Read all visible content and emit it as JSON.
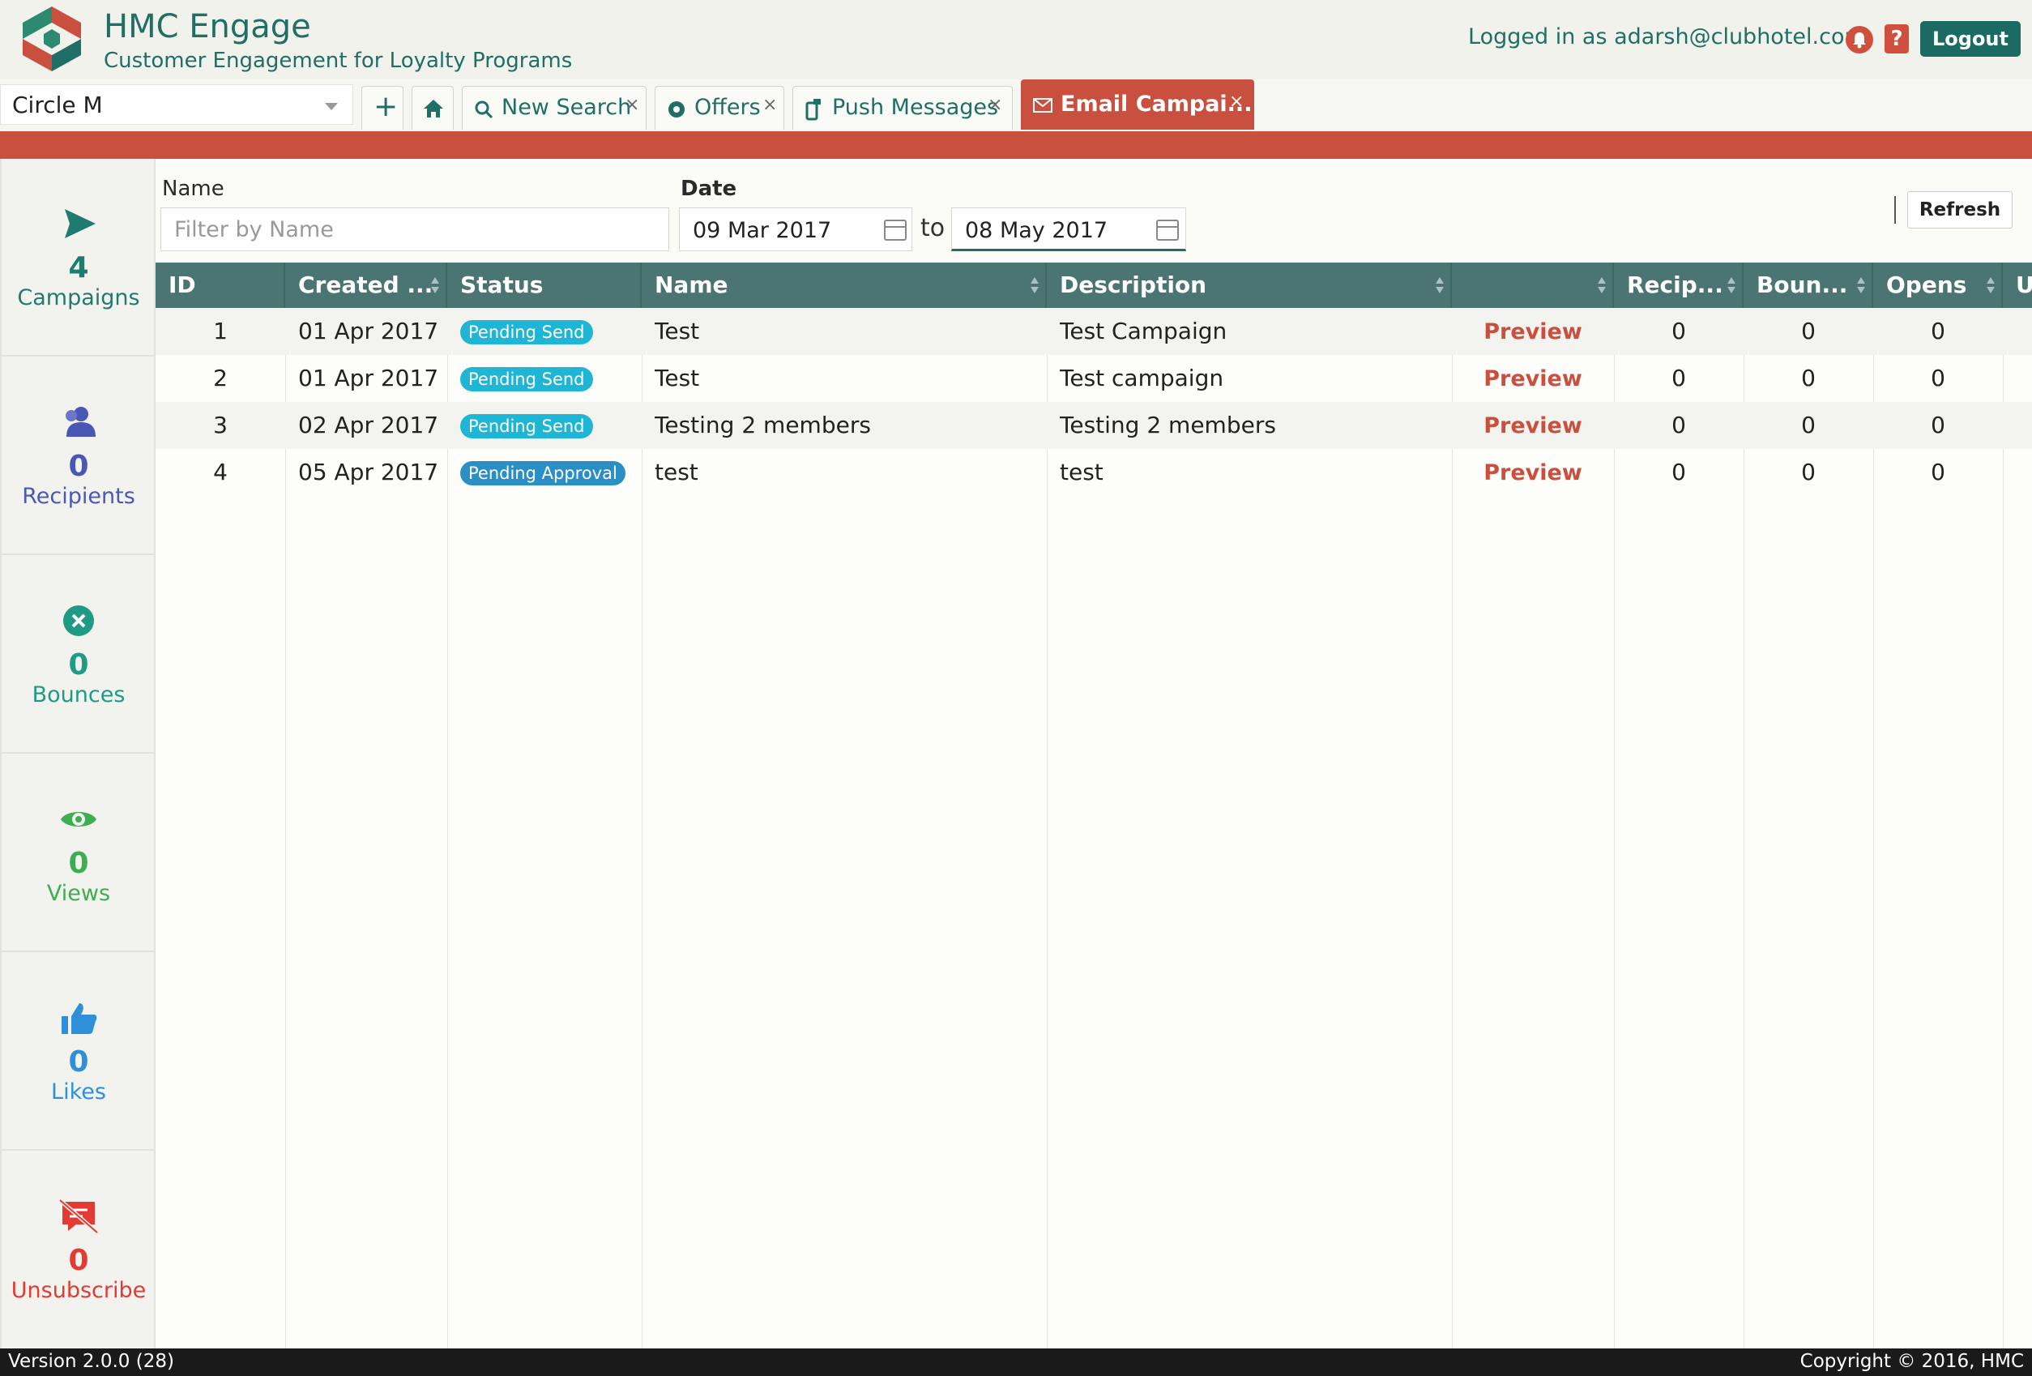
{
  "header": {
    "title": "HMC Engage",
    "subtitle": "Customer Engagement for Loyalty Programs",
    "login_text": "Logged in as adarsh@clubhotel.com",
    "help_label": "?",
    "logout_label": "Logout"
  },
  "tabbar": {
    "circle_value": "Circle M",
    "add_label": "+",
    "tabs": [
      {
        "label": "New Search",
        "icon": "search-icon",
        "close": "×"
      },
      {
        "label": "Offers",
        "icon": "gear-icon",
        "close": "×"
      },
      {
        "label": "Push Messages",
        "icon": "phone-icon",
        "close": "×"
      },
      {
        "label": "Email Campai...",
        "icon": "envelope-icon",
        "close": "×"
      }
    ]
  },
  "sidebar": {
    "stats": [
      {
        "value": "4",
        "label": "Campaigns",
        "icon": "send-icon",
        "color": "#1f7a70"
      },
      {
        "value": "0",
        "label": "Recipients",
        "icon": "users-icon",
        "color": "#4a57b5"
      },
      {
        "value": "0",
        "label": "Bounces",
        "icon": "x-circle-icon",
        "color": "#1f9a84"
      },
      {
        "value": "0",
        "label": "Views",
        "icon": "eye-icon",
        "color": "#3fae52"
      },
      {
        "value": "0",
        "label": "Likes",
        "icon": "thumbs-up-icon",
        "color": "#2f8fd8"
      },
      {
        "value": "0",
        "label": "Unsubscribe",
        "icon": "unsubscribe-icon",
        "color": "#e23b33"
      }
    ]
  },
  "filters": {
    "name_label": "Name",
    "name_placeholder": "Filter by Name",
    "date_label": "Date",
    "date_from": "09 Mar 2017",
    "to_label": "to",
    "date_to": "08 May 2017",
    "refresh_label": "Refresh"
  },
  "table": {
    "headers": [
      "ID",
      "Created ...",
      "Status",
      "Name",
      "Description",
      "",
      "Recip...",
      "Boun...",
      "Opens",
      "U"
    ],
    "rows": [
      {
        "id": "1",
        "created": "01 Apr 2017",
        "status": "Pending Send",
        "name": "Test",
        "description": "Test Campaign",
        "action": "Preview",
        "recipients": "0",
        "bounces": "0",
        "opens": "0"
      },
      {
        "id": "2",
        "created": "01 Apr 2017",
        "status": "Pending Send",
        "name": "Test",
        "description": "Test campaign",
        "action": "Preview",
        "recipients": "0",
        "bounces": "0",
        "opens": "0"
      },
      {
        "id": "3",
        "created": "02 Apr 2017",
        "status": "Pending Send",
        "name": "Testing 2 members",
        "description": "Testing 2 members",
        "action": "Preview",
        "recipients": "0",
        "bounces": "0",
        "opens": "0"
      },
      {
        "id": "4",
        "created": "05 Apr 2017",
        "status": "Pending Approval",
        "name": "test",
        "description": "test",
        "action": "Preview",
        "recipients": "0",
        "bounces": "0",
        "opens": "0"
      }
    ]
  },
  "footer": {
    "version": "Version 2.0.0 (28)",
    "copyright": "Copyright © 2016, HMC"
  }
}
